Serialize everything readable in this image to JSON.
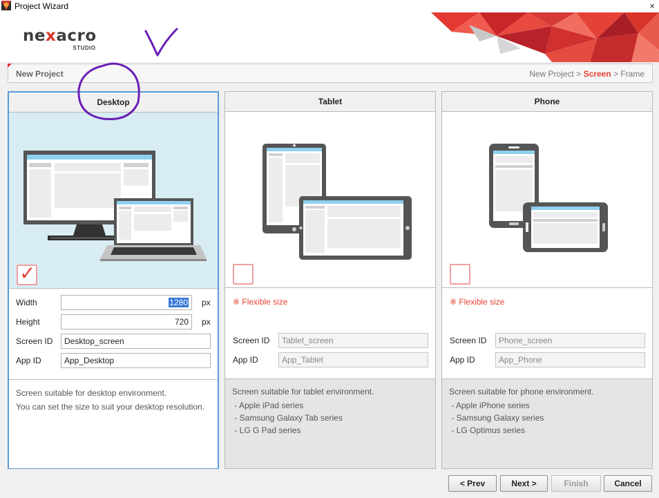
{
  "window": {
    "title": "Project Wizard",
    "close_glyph": "×"
  },
  "logo": {
    "pre": "ne",
    "x": "x",
    "post": "acro",
    "sub": "STUDIO"
  },
  "breadcrumb": {
    "title": "New Project",
    "steps": [
      "New Project",
      "Screen",
      "Frame"
    ],
    "active": "Screen",
    "sep": ">"
  },
  "panels": [
    {
      "title": "Desktop",
      "checked": true,
      "fields": [
        {
          "label": "Width",
          "value": "1280",
          "unit": "px"
        },
        {
          "label": "Height",
          "value": "720",
          "unit": "px"
        },
        {
          "label": "Screen ID",
          "value": "Desktop_screen"
        },
        {
          "label": "App ID",
          "value": "App_Desktop"
        }
      ],
      "desc": [
        "Screen suitable for desktop environment.",
        "You can set the size to suit your desktop resolution."
      ]
    },
    {
      "title": "Tablet",
      "checked": false,
      "flexible": "※ Flexible size",
      "fields": [
        {
          "label": "Screen ID",
          "placeholder": "Tablet_screen"
        },
        {
          "label": "App ID",
          "placeholder": "App_Tablet"
        }
      ],
      "desc": [
        "Screen suitable for tablet environment.",
        " - Apple iPad series",
        " - Samsung Galaxy Tab series",
        " - LG G Pad series"
      ]
    },
    {
      "title": "Phone",
      "checked": false,
      "flexible": "※ Flexible size",
      "fields": [
        {
          "label": "Screen ID",
          "placeholder": "Phone_screen"
        },
        {
          "label": "App ID",
          "placeholder": "App_Phone"
        }
      ],
      "desc": [
        "Screen suitable for phone environment.",
        " - Apple iPhone series",
        " - Samsung Galaxy series",
        " - LG Optimus series"
      ]
    }
  ],
  "buttons": {
    "prev": "< Prev",
    "next": "Next >",
    "finish": "Finish",
    "cancel": "Cancel"
  },
  "colors": {
    "accent": "#e8402f",
    "selection_border": "#5a9ad6",
    "selected_bg": "#d8ecf3",
    "annotation": "#6a1fb5"
  }
}
